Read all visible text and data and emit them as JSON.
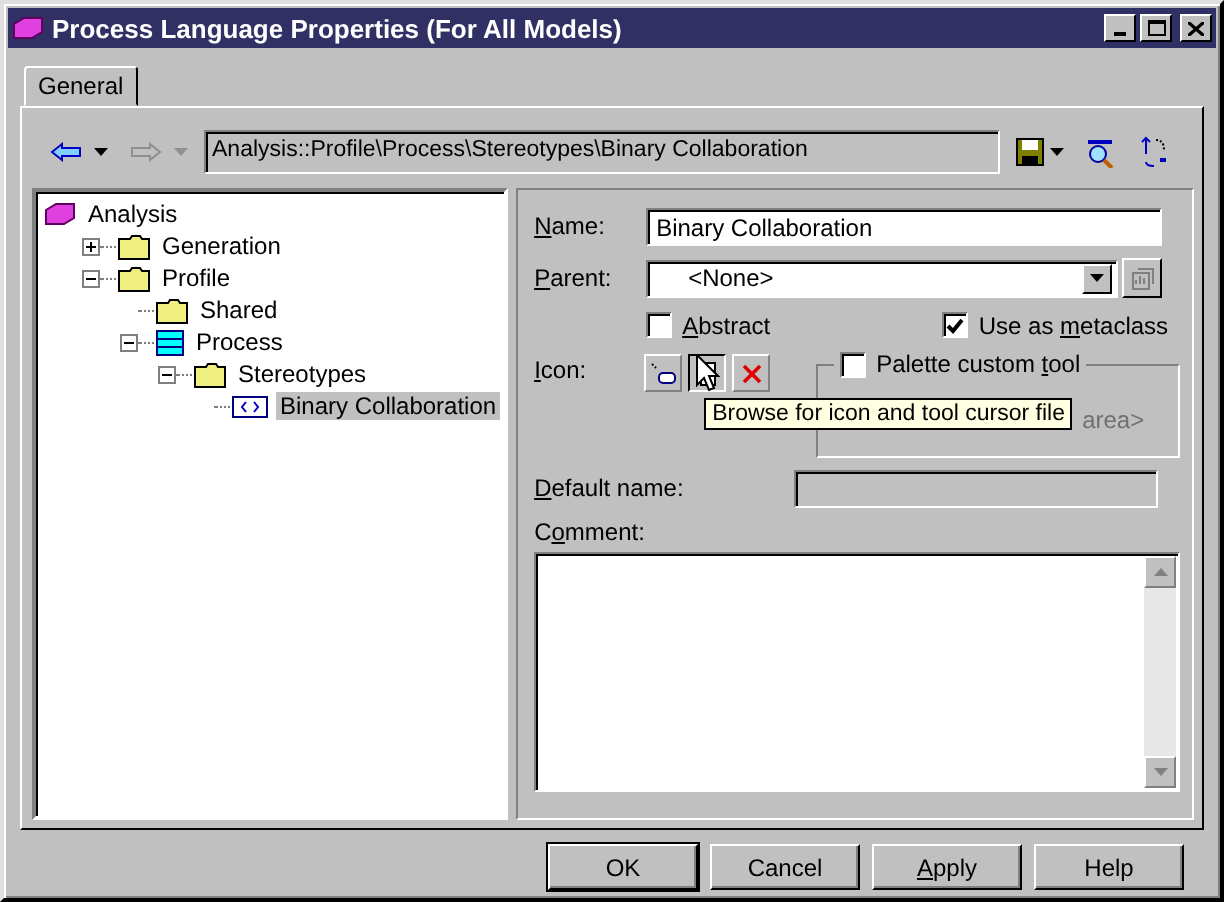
{
  "window": {
    "title": "Process Language Properties (For All Models)"
  },
  "tabs": [
    {
      "label": "General",
      "selected": true
    }
  ],
  "toolbar": {
    "nav": [
      {
        "kind": "back",
        "disabled": false
      },
      {
        "kind": "forward",
        "disabled": true
      }
    ],
    "path": "Analysis::Profile\\Process\\Stereotypes\\Binary Collaboration"
  },
  "tree": [
    {
      "label": "Analysis",
      "kind": "package",
      "selected": false,
      "children": [
        {
          "label": "Generation",
          "kind": "folder",
          "selected": false,
          "expanded": false
        },
        {
          "label": "Profile",
          "kind": "folder",
          "selected": false,
          "expanded": true,
          "children": [
            {
              "label": "Shared",
              "kind": "folder",
              "selected": false
            },
            {
              "label": "Process",
              "kind": "process",
              "selected": false,
              "expanded": true,
              "children": [
                {
                  "label": "Stereotypes",
                  "kind": "folder",
                  "selected": false,
                  "expanded": true,
                  "children": [
                    {
                      "label": "Binary Collaboration",
                      "kind": "stereotype",
                      "selected": true
                    }
                  ]
                }
              ]
            }
          ]
        }
      ]
    }
  ],
  "form": {
    "name": {
      "label": {
        "key": "N",
        "post": "ame:"
      },
      "value": "Binary Collaboration"
    },
    "parent": {
      "label": {
        "key": "P",
        "post": "arent:"
      },
      "value": "<None>"
    },
    "abstract": {
      "label": {
        "key": "A",
        "post": "bstract"
      },
      "checked": false
    },
    "use_as_metaclass": {
      "label": {
        "pre": "Use as ",
        "key": "m",
        "post": "etaclass"
      },
      "checked": true
    },
    "icon": {
      "label": {
        "key": "I",
        "post": "con:"
      }
    },
    "palette_custom_tool": {
      "label": {
        "pre": "Palette custom ",
        "key": "t",
        "post": "ool"
      },
      "checked": false,
      "preview_text": "area>"
    },
    "default_name": {
      "label": {
        "key": "D",
        "post": "efault name:"
      },
      "disabled": true
    },
    "comment": {
      "label": {
        "pre": "C",
        "key": "o",
        "post": "mment:"
      }
    }
  },
  "tooltip": "Browse for icon and tool cursor file",
  "buttons": [
    {
      "label": {
        "pre": "OK"
      },
      "default": true
    },
    {
      "label": {
        "pre": "Cancel"
      },
      "default": false
    },
    {
      "label": {
        "key": "A",
        "post": "pply"
      },
      "default": false
    },
    {
      "label": {
        "pre": "Help"
      },
      "default": false
    }
  ]
}
